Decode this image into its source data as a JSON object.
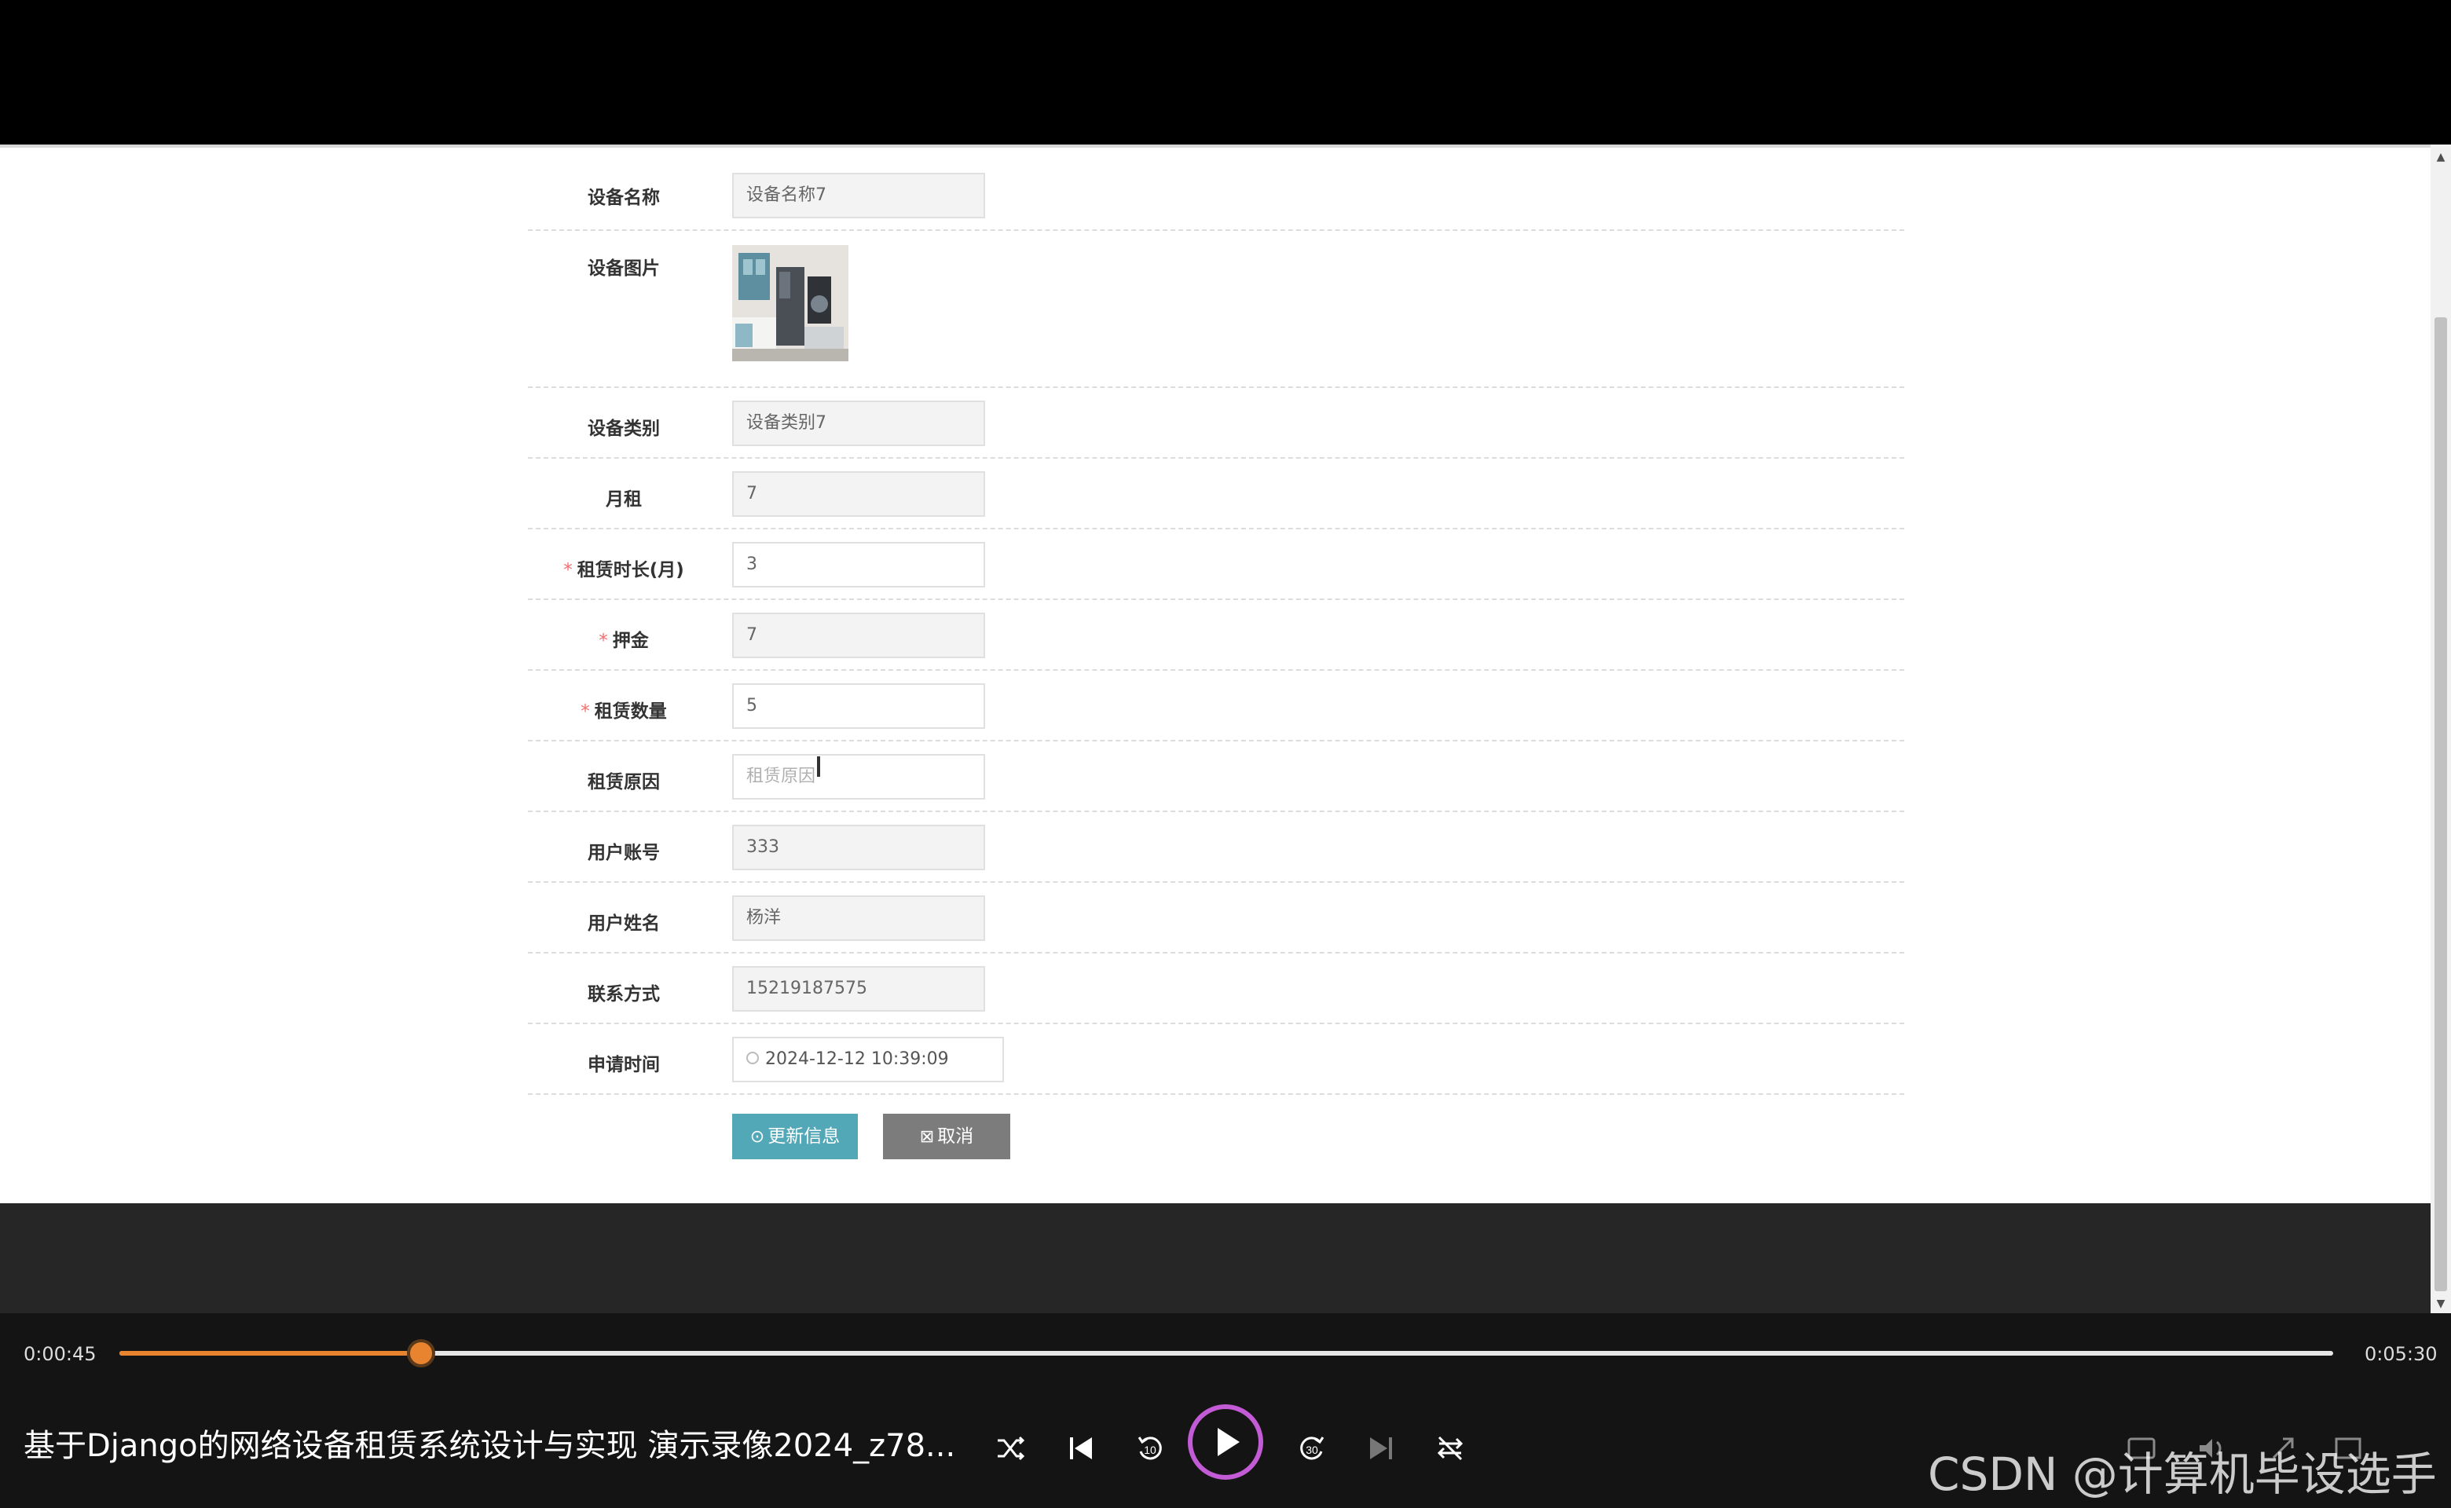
{
  "form": {
    "rows": [
      {
        "label": "设备名称",
        "value": "设备名称7",
        "required": false
      },
      {
        "label": "设备图片",
        "required": false
      },
      {
        "label": "设备类别",
        "value": "设备类别7",
        "required": false
      },
      {
        "label": "月租",
        "value": "7",
        "required": false
      },
      {
        "label": "租赁时长(月)",
        "value": "3",
        "required": true
      },
      {
        "label": "押金",
        "value": "7",
        "required": true
      },
      {
        "label": "租赁数量",
        "value": "5",
        "required": true
      },
      {
        "label": "租赁原因",
        "placeholder": "租赁原因",
        "required": false
      },
      {
        "label": "用户账号",
        "value": "333",
        "required": false
      },
      {
        "label": "用户姓名",
        "value": "杨洋",
        "required": false
      },
      {
        "label": "联系方式",
        "value": "15219187575",
        "required": false
      },
      {
        "label": "申请时间",
        "value": "2024-12-12 10:39:09",
        "required": false
      }
    ],
    "required_mark": "*",
    "update_button": "更新信息",
    "cancel_button": "取消"
  },
  "player": {
    "current_time": "0:00:45",
    "total_time": "0:05:30",
    "progress": 0.1364,
    "title": "基于Django的网络设备租赁系统设计与实现 演示录像2024_z78...",
    "accent_color": "#e8842f"
  },
  "watermark": "CSDN @计算机毕设选手"
}
